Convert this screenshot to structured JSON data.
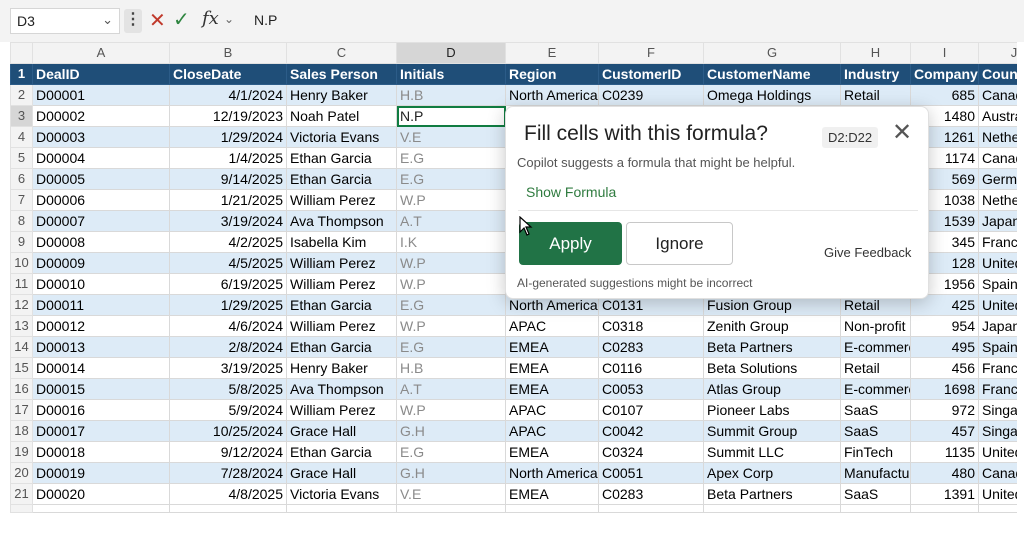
{
  "formula_bar": {
    "cell_ref": "D3",
    "namebox_chevron_icon": "chevron-down-icon",
    "more_icon": "vertical-dots-icon",
    "cancel_icon": "close-icon",
    "enter_icon": "checkmark-icon",
    "fx": "fx",
    "fx_chevron_icon": "chevron-down-icon",
    "content": "N.P"
  },
  "grid": {
    "columns": [
      "A",
      "B",
      "C",
      "D",
      "E",
      "F",
      "G",
      "H",
      "I",
      "J"
    ],
    "selected_column": "D",
    "selected_row": "3",
    "header_row": {
      "num": "1",
      "cells": [
        "DealID",
        "CloseDate",
        "Sales Person",
        "Initials",
        "Region",
        "CustomerID",
        "CustomerName",
        "Industry",
        "CompanySize",
        "Country"
      ]
    },
    "rows": [
      {
        "num": "2",
        "cells": [
          "D00001",
          "4/1/2024",
          "Henry Baker",
          "H.B",
          "North America",
          "C0239",
          "Omega Holdings",
          "Retail",
          "685",
          "Canada"
        ]
      },
      {
        "num": "3",
        "cells": [
          "D00002",
          "12/19/2023",
          "Noah Patel",
          "N.P",
          "",
          "",
          "",
          "",
          "1480",
          "Australia"
        ]
      },
      {
        "num": "4",
        "cells": [
          "D00003",
          "1/29/2024",
          "Victoria Evans",
          "V.E",
          "",
          "",
          "",
          "",
          "1261",
          "Netherlands"
        ]
      },
      {
        "num": "5",
        "cells": [
          "D00004",
          "1/4/2025",
          "Ethan Garcia",
          "E.G",
          "",
          "",
          "",
          "",
          "1174",
          "Canada"
        ]
      },
      {
        "num": "6",
        "cells": [
          "D00005",
          "9/14/2025",
          "Ethan Garcia",
          "E.G",
          "",
          "",
          "",
          "",
          "569",
          "Germany"
        ]
      },
      {
        "num": "7",
        "cells": [
          "D00006",
          "1/21/2025",
          "William Perez",
          "W.P",
          "",
          "",
          "",
          "",
          "1038",
          "Netherlands"
        ]
      },
      {
        "num": "8",
        "cells": [
          "D00007",
          "3/19/2024",
          "Ava Thompson",
          "A.T",
          "",
          "",
          "",
          "",
          "1539",
          "Japan"
        ]
      },
      {
        "num": "9",
        "cells": [
          "D00008",
          "4/2/2025",
          "Isabella Kim",
          "I.K",
          "",
          "",
          "",
          "",
          "345",
          "France"
        ]
      },
      {
        "num": "10",
        "cells": [
          "D00009",
          "4/5/2025",
          "William Perez",
          "W.P",
          "",
          "",
          "",
          "",
          "128",
          "United States"
        ]
      },
      {
        "num": "11",
        "cells": [
          "D00010",
          "6/19/2025",
          "William Perez",
          "W.P",
          "",
          "",
          "",
          "",
          "1956",
          "Spain"
        ]
      },
      {
        "num": "12",
        "cells": [
          "D00011",
          "1/29/2025",
          "Ethan Garcia",
          "E.G",
          "North America",
          "C0131",
          "Fusion Group",
          "Retail",
          "425",
          "United States"
        ]
      },
      {
        "num": "13",
        "cells": [
          "D00012",
          "4/6/2024",
          "William Perez",
          "W.P",
          "APAC",
          "C0318",
          "Zenith Group",
          "Non-profit",
          "954",
          "Japan"
        ]
      },
      {
        "num": "14",
        "cells": [
          "D00013",
          "2/8/2024",
          "Ethan Garcia",
          "E.G",
          "EMEA",
          "C0283",
          "Beta Partners",
          "E-commerce",
          "495",
          "Spain"
        ]
      },
      {
        "num": "15",
        "cells": [
          "D00014",
          "3/19/2025",
          "Henry Baker",
          "H.B",
          "EMEA",
          "C0116",
          "Beta Solutions",
          "Retail",
          "456",
          "France"
        ]
      },
      {
        "num": "16",
        "cells": [
          "D00015",
          "5/8/2025",
          "Ava Thompson",
          "A.T",
          "EMEA",
          "C0053",
          "Atlas Group",
          "E-commerce",
          "1698",
          "France"
        ]
      },
      {
        "num": "17",
        "cells": [
          "D00016",
          "5/9/2024",
          "William Perez",
          "W.P",
          "APAC",
          "C0107",
          "Pioneer Labs",
          "SaaS",
          "972",
          "Singapore"
        ]
      },
      {
        "num": "18",
        "cells": [
          "D00017",
          "10/25/2024",
          "Grace Hall",
          "G.H",
          "APAC",
          "C0042",
          "Summit Group",
          "SaaS",
          "457",
          "Singapore"
        ]
      },
      {
        "num": "19",
        "cells": [
          "D00018",
          "9/12/2024",
          "Ethan Garcia",
          "E.G",
          "EMEA",
          "C0324",
          "Summit LLC",
          "FinTech",
          "1135",
          "United States"
        ]
      },
      {
        "num": "20",
        "cells": [
          "D00019",
          "7/28/2024",
          "Grace Hall",
          "G.H",
          "North America",
          "C0051",
          "Apex Corp",
          "Manufacturing",
          "480",
          "Canada"
        ]
      },
      {
        "num": "21",
        "cells": [
          "D00020",
          "4/8/2025",
          "Victoria Evans",
          "V.E",
          "EMEA",
          "C0283",
          "Beta Partners",
          "SaaS",
          "1391",
          "United States"
        ]
      }
    ]
  },
  "copilot": {
    "title": "Fill cells with this formula?",
    "range": "D2:D22",
    "close_icon": "close-icon",
    "subtitle": "Copilot suggests a formula that might be helpful.",
    "show_formula": "Show Formula",
    "apply": "Apply",
    "ignore": "Ignore",
    "feedback": "Give Feedback",
    "disclaimer": "AI-generated suggestions might be incorrect"
  },
  "colors": {
    "header_fill": "#1f4e78",
    "band_fill": "#ddebf7",
    "excel_green": "#217346",
    "link_green": "#2f7b3f",
    "cancel_red": "#c0392b"
  },
  "cursor_icon": "mouse-pointer-icon"
}
